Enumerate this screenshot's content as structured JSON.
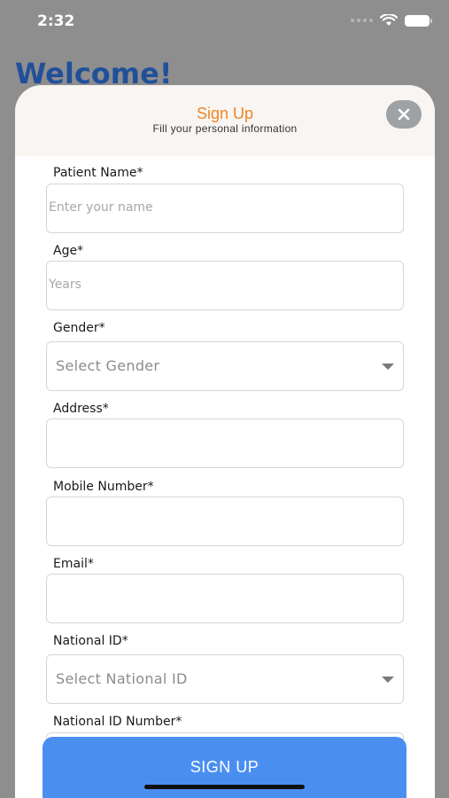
{
  "status_bar": {
    "time": "2:32",
    "icons": [
      "signal-dots-icon",
      "wifi-icon",
      "battery-icon"
    ]
  },
  "background": {
    "welcome_text": "Welcome!"
  },
  "sheet": {
    "title": "Sign Up",
    "subtitle": "Fill your personal information",
    "close_icon": "close-icon"
  },
  "form": {
    "patient_name": {
      "label": "Patient Name*",
      "placeholder": "Enter your name",
      "value": ""
    },
    "age": {
      "label": "Age*",
      "placeholder": "Years",
      "value": ""
    },
    "gender": {
      "label": "Gender*",
      "selected": "Select Gender"
    },
    "address": {
      "label": "Address*",
      "value": ""
    },
    "mobile": {
      "label": "Mobile Number*",
      "value": ""
    },
    "email": {
      "label": "Email*",
      "value": ""
    },
    "national_id": {
      "label": "National ID*",
      "selected": "Select National ID"
    },
    "national_id_number": {
      "label": "National ID Number*",
      "value": ""
    }
  },
  "actions": {
    "signup_label": "SIGN UP"
  },
  "colors": {
    "accent_orange": "#ee8626",
    "button_blue": "#4a8ff0",
    "welcome_blue": "#21509a",
    "overlay_gray": "#8e8e8e"
  }
}
